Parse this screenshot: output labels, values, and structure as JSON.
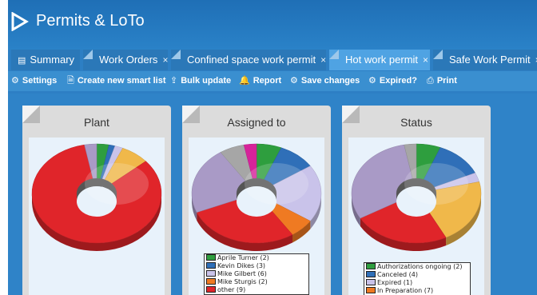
{
  "app": {
    "title": "Permits & LoTo"
  },
  "tabs": [
    {
      "label": "Summary",
      "icon": "list-icon",
      "closable": false,
      "active": false
    },
    {
      "label": "Work Orders",
      "closable": true,
      "active": false
    },
    {
      "label": "Confined space work permit",
      "closable": true,
      "active": false
    },
    {
      "label": "Hot work permit",
      "closable": true,
      "active": true
    },
    {
      "label": "Safe Work Permit",
      "closable": true,
      "active": false
    }
  ],
  "tab_close_glyph": "×",
  "toolbar": [
    {
      "label": "Settings",
      "icon": "gear-icon"
    },
    {
      "label": "Create new smart list",
      "icon": "document-icon"
    },
    {
      "label": "Bulk update",
      "icon": "upload-icon"
    },
    {
      "label": "Report",
      "icon": "bell-icon"
    },
    {
      "label": "Save changes",
      "icon": "gear-icon"
    },
    {
      "label": "Expired?",
      "icon": "gear-icon"
    },
    {
      "label": "Print",
      "icon": "print-icon"
    }
  ],
  "cards": [
    {
      "title": "Plant"
    },
    {
      "title": "Assigned to",
      "legend": [
        {
          "label": "Aprile Turner (2)",
          "color": "#2e9e3e"
        },
        {
          "label": "Kevin Dikes (3)",
          "color": "#2f6fb8"
        },
        {
          "label": "Mike Gilbert (6)",
          "color": "#c9c3ea"
        },
        {
          "label": "Mike Sturgis (2)",
          "color": "#ef7a22"
        },
        {
          "label": "other (9)",
          "color": "#e0252a"
        }
      ]
    },
    {
      "title": "Status",
      "legend": [
        {
          "label": "Authorizations ongoing (2)",
          "color": "#2e9e3e"
        },
        {
          "label": "Canceled (4)",
          "color": "#2f6fb8"
        },
        {
          "label": "Expired (1)",
          "color": "#c9c3ea"
        },
        {
          "label": "In Preparation (7)",
          "color": "#ef7a22"
        }
      ]
    }
  ],
  "chart_data": [
    {
      "type": "pie",
      "title": "Plant",
      "slices": [
        {
          "value": 3,
          "color": "#2e9e3e"
        },
        {
          "value": 1.5,
          "color": "#2f6fb8"
        },
        {
          "value": 2,
          "color": "#c9c3ea"
        },
        {
          "value": 7,
          "color": "#f0b84a"
        },
        {
          "value": 82,
          "color": "#e0252a"
        },
        {
          "value": 3,
          "color": "#a99ac6"
        }
      ]
    },
    {
      "type": "pie",
      "title": "Assigned to",
      "series": [
        {
          "name": "Aprile Turner (2)",
          "value": 2,
          "color": "#2e9e3e"
        },
        {
          "name": "Kevin Dikes (3)",
          "value": 3,
          "color": "#2f6fb8"
        },
        {
          "name": "Mike Gilbert (6)",
          "value": 6,
          "color": "#c9c3ea"
        },
        {
          "name": "Mike Sturgis (2)",
          "value": 2,
          "color": "#ef7a22"
        },
        {
          "name": "other (9)",
          "value": 9,
          "color": "#e0252a"
        },
        {
          "value": 7,
          "color": "#a99ac6"
        },
        {
          "value": 2,
          "color": "#a6a6a6"
        },
        {
          "value": 1,
          "color": "#d6239a"
        }
      ]
    },
    {
      "type": "pie",
      "title": "Status",
      "series": [
        {
          "name": "Authorizations ongoing (2)",
          "value": 2,
          "color": "#2e9e3e"
        },
        {
          "name": "Canceled (4)",
          "value": 4,
          "color": "#2f6fb8"
        },
        {
          "name": "Expired (1)",
          "value": 1,
          "color": "#c9c3ea"
        },
        {
          "name": "In Preparation (7)",
          "value": 7,
          "color": "#f0b84a"
        },
        {
          "value": 8,
          "color": "#e0252a"
        },
        {
          "value": 10,
          "color": "#a99ac6"
        },
        {
          "value": 1,
          "color": "#a6a6a6"
        }
      ]
    }
  ]
}
